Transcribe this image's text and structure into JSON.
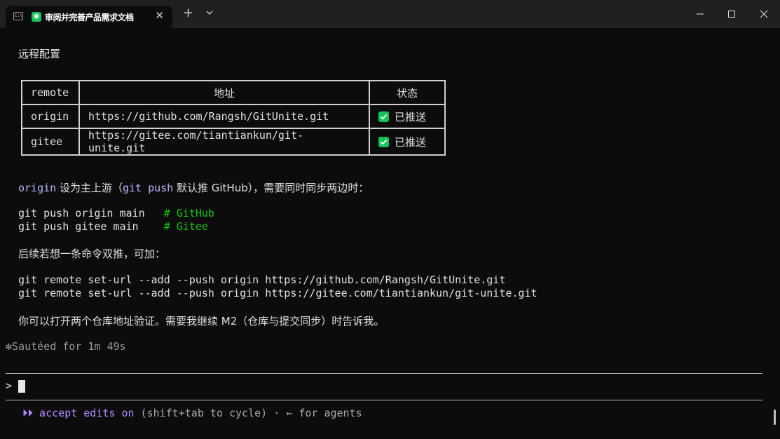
{
  "window": {
    "tab_title": "审阅并完善产品需求文档",
    "terminal_icon_text": "C:\\",
    "app_icon_glyph": "✱",
    "tab_close": "✕",
    "new_tab": "+"
  },
  "content": {
    "heading": "远程配置",
    "table": {
      "headers": [
        "remote",
        "地址",
        "状态"
      ],
      "rows": [
        {
          "remote": "origin",
          "address": "https://github.com/Rangsh/GitUnite.git",
          "status": "已推送"
        },
        {
          "remote": "gitee",
          "address": "https://gitee.com/tiantiankun/git-unite.git",
          "status": "已推送"
        }
      ]
    },
    "upstream_line": {
      "origin": "origin",
      "text1": " 设为主上游（",
      "git_push": "git push",
      "text2": " 默认推 GitHub），需要同时同步两边时："
    },
    "push_cmds": [
      {
        "cmd": "git push origin main   ",
        "comment": "# GitHub"
      },
      {
        "cmd": "git push gitee main    ",
        "comment": "# Gitee"
      }
    ],
    "followup_text": "后续若想一条命令双推，可加：",
    "remote_cmds": [
      "git remote set-url --add --push origin https://github.com/Rangsh/GitUnite.git",
      "git remote set-url --add --push origin https://gitee.com/tiantiankun/git-unite.git"
    ],
    "closing_text": "你可以打开两个仓库地址验证。需要我继续 M2（仓库与提交同步）时告诉我。",
    "spinner_glyph": "✻",
    "spinner_text": "Sautéed for 1m 49s"
  },
  "prompt": {
    "caret": ">"
  },
  "status": {
    "arrows": "⏵⏵",
    "mode": "accept edits on",
    "hint": " (shift+tab to cycle) · ← for agents"
  },
  "colors": {
    "background": "#0c0c0c",
    "accent_purple": "#b18cff",
    "keyword": "#b9b7ff",
    "comment_green": "#16c60c",
    "check_green": "#16c35a"
  }
}
